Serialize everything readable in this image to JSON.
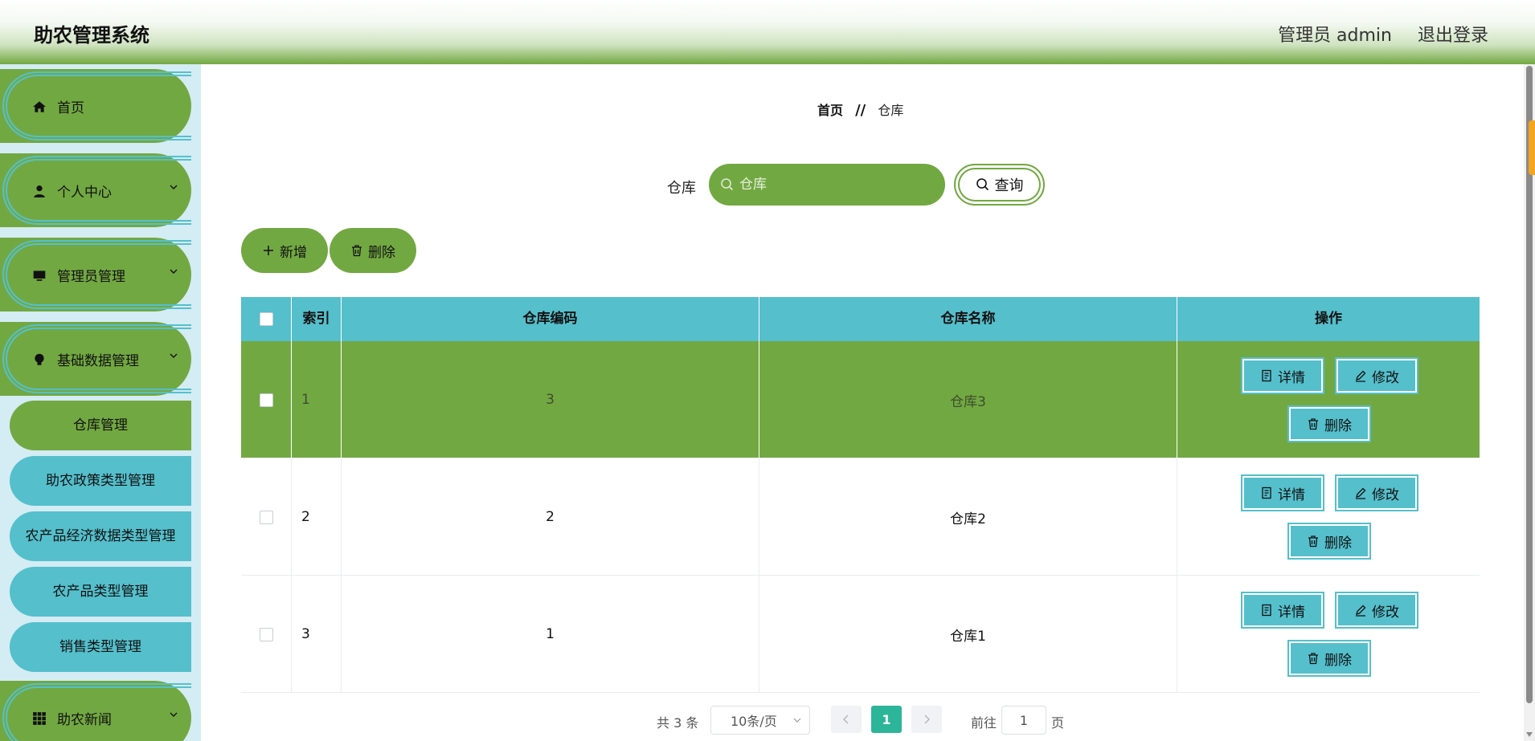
{
  "header": {
    "brand": "助农管理系统",
    "user": "管理员 admin",
    "logout": "退出登录"
  },
  "sidebar": {
    "items": [
      {
        "label": "首页",
        "icon": "home-icon",
        "has_chevron": false
      },
      {
        "label": "个人中心",
        "icon": "user-icon",
        "has_chevron": true
      },
      {
        "label": "管理员管理",
        "icon": "monitor-icon",
        "has_chevron": true
      },
      {
        "label": "基础数据管理",
        "icon": "bulb-icon",
        "has_chevron": true
      },
      {
        "label": "助农新闻",
        "icon": "grid-icon",
        "has_chevron": true
      }
    ],
    "sub_items": [
      {
        "label": "仓库管理",
        "active": true
      },
      {
        "label": "助农政策类型管理",
        "active": false
      },
      {
        "label": "农产品经济数据类型管理",
        "active": false
      },
      {
        "label": "农产品类型管理",
        "active": false
      },
      {
        "label": "销售类型管理",
        "active": false
      }
    ]
  },
  "breadcrumb": {
    "home": "首页",
    "separator": "//",
    "current": "仓库"
  },
  "search": {
    "label": "仓库",
    "placeholder": "仓库",
    "value": "",
    "button": "查询"
  },
  "actions": {
    "add": "新增",
    "delete": "删除"
  },
  "table": {
    "headers": [
      "索引",
      "仓库编码",
      "仓库名称",
      "操作"
    ],
    "rows": [
      {
        "index": "1",
        "code": "3",
        "name": "仓库3",
        "highlight": true
      },
      {
        "index": "2",
        "code": "2",
        "name": "仓库2",
        "highlight": false
      },
      {
        "index": "3",
        "code": "1",
        "name": "仓库1",
        "highlight": false
      }
    ],
    "row_actions": {
      "detail": "详情",
      "edit": "修改",
      "delete": "删除"
    }
  },
  "pagination": {
    "total": "共 3 条",
    "page_size": "10条/页",
    "current_page": "1",
    "goto_label": "前往",
    "goto_value": "1",
    "page_suffix": "页"
  },
  "colors": {
    "green": "#72a842",
    "teal": "#55bfcc",
    "sidebar_bg": "#d4ecf4",
    "page_active": "#2db59a"
  }
}
